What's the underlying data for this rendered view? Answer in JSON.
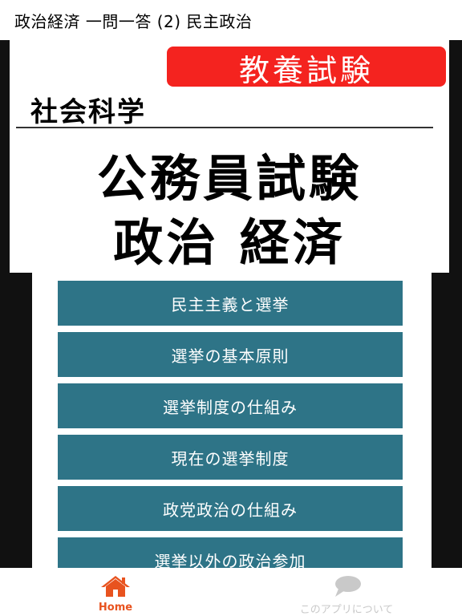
{
  "header": {
    "title": "政治経済 一問一答 (2) 民主政治"
  },
  "cover": {
    "badge": "教養試験",
    "subject": "社会科学",
    "headline_line1": "公務員試験",
    "headline_line2": "政治 経済"
  },
  "menu": {
    "items": [
      {
        "label": "民主主義と選挙"
      },
      {
        "label": "選挙の基本原則"
      },
      {
        "label": "選挙制度の仕組み"
      },
      {
        "label": "現在の選挙制度"
      },
      {
        "label": "政党政治の仕組み"
      },
      {
        "label": "選挙以外の政治参加"
      }
    ]
  },
  "tabbar": {
    "home": {
      "label": "Home",
      "icon": "home-icon",
      "color": "#e8531f"
    },
    "about": {
      "label": "このアプリについて",
      "icon": "speech-bubble-icon",
      "color": "#c9c9c9"
    }
  },
  "colors": {
    "accent": "#e8531f",
    "badge_red": "#f4231f",
    "menu_teal": "#2e7487",
    "frame_dark": "#111111"
  }
}
